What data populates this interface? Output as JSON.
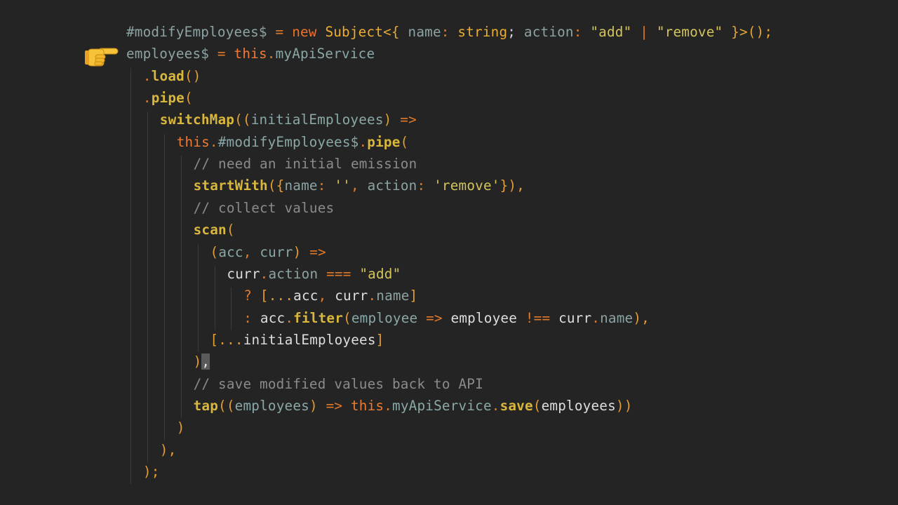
{
  "editor": {
    "theme": {
      "background": "#242424",
      "keyword": "#f0712a",
      "type": "#ecae2e",
      "string": "#d3c45c",
      "function": "#d8b73c",
      "comment": "#8b8b8b",
      "field": "#8da3a3",
      "indent_guide": "#3b3b3b",
      "selection": "#5a5a5a"
    },
    "pointer_icon": "pointing-hand-emoji",
    "lines": [
      {
        "indent": 0,
        "tokens": [
          {
            "t": "#modifyEmployees$",
            "c": "field"
          },
          {
            "t": " = ",
            "c": "op"
          },
          {
            "t": "new",
            "c": "kw"
          },
          {
            "t": " ",
            "c": "plain"
          },
          {
            "t": "Subject",
            "c": "type"
          },
          {
            "t": "<{ ",
            "c": "punct"
          },
          {
            "t": "name",
            "c": "field"
          },
          {
            "t": ": ",
            "c": "op"
          },
          {
            "t": "string",
            "c": "type"
          },
          {
            "t": "; ",
            "c": "plain"
          },
          {
            "t": "action",
            "c": "field"
          },
          {
            "t": ": ",
            "c": "op"
          },
          {
            "t": "\"add\"",
            "c": "str"
          },
          {
            "t": " | ",
            "c": "op"
          },
          {
            "t": "\"remove\"",
            "c": "str"
          },
          {
            "t": " }>();",
            "c": "punct"
          }
        ]
      },
      {
        "indent": 0,
        "tokens": [
          {
            "t": "employees$",
            "c": "field"
          },
          {
            "t": " = ",
            "c": "op"
          },
          {
            "t": "this",
            "c": "this"
          },
          {
            "t": ".",
            "c": "op"
          },
          {
            "t": "myApiService",
            "c": "var"
          }
        ]
      },
      {
        "indent": 1,
        "tokens": [
          {
            "t": ".",
            "c": "op"
          },
          {
            "t": "load",
            "c": "fn"
          },
          {
            "t": "()",
            "c": "paren"
          }
        ]
      },
      {
        "indent": 1,
        "tokens": [
          {
            "t": ".",
            "c": "op"
          },
          {
            "t": "pipe",
            "c": "fn"
          },
          {
            "t": "(",
            "c": "paren"
          }
        ]
      },
      {
        "indent": 2,
        "tokens": [
          {
            "t": "switchMap",
            "c": "fn"
          },
          {
            "t": "((",
            "c": "paren"
          },
          {
            "t": "initialEmployees",
            "c": "var"
          },
          {
            "t": ") ",
            "c": "paren"
          },
          {
            "t": "=>",
            "c": "op"
          }
        ]
      },
      {
        "indent": 3,
        "tokens": [
          {
            "t": "this",
            "c": "this"
          },
          {
            "t": ".",
            "c": "op"
          },
          {
            "t": "#modifyEmployees$",
            "c": "var"
          },
          {
            "t": ".",
            "c": "op"
          },
          {
            "t": "pipe",
            "c": "fn"
          },
          {
            "t": "(",
            "c": "paren"
          }
        ]
      },
      {
        "indent": 4,
        "tokens": [
          {
            "t": "// need an initial emission",
            "c": "cm"
          }
        ]
      },
      {
        "indent": 4,
        "tokens": [
          {
            "t": "startWith",
            "c": "fn"
          },
          {
            "t": "({",
            "c": "paren"
          },
          {
            "t": "name",
            "c": "field"
          },
          {
            "t": ": ",
            "c": "op"
          },
          {
            "t": "''",
            "c": "str"
          },
          {
            "t": ", ",
            "c": "op"
          },
          {
            "t": "action",
            "c": "field"
          },
          {
            "t": ": ",
            "c": "op"
          },
          {
            "t": "'remove'",
            "c": "str"
          },
          {
            "t": "}),",
            "c": "paren"
          }
        ]
      },
      {
        "indent": 4,
        "tokens": [
          {
            "t": "// collect values",
            "c": "cm"
          }
        ]
      },
      {
        "indent": 4,
        "tokens": [
          {
            "t": "scan",
            "c": "fn"
          },
          {
            "t": "(",
            "c": "paren"
          }
        ]
      },
      {
        "indent": 5,
        "tokens": [
          {
            "t": "(",
            "c": "paren"
          },
          {
            "t": "acc",
            "c": "var"
          },
          {
            "t": ", ",
            "c": "op"
          },
          {
            "t": "curr",
            "c": "var"
          },
          {
            "t": ") ",
            "c": "paren"
          },
          {
            "t": "=>",
            "c": "op"
          }
        ]
      },
      {
        "indent": 6,
        "tokens": [
          {
            "t": "curr",
            "c": "white"
          },
          {
            "t": ".",
            "c": "op"
          },
          {
            "t": "action",
            "c": "field"
          },
          {
            "t": " === ",
            "c": "op"
          },
          {
            "t": "\"add\"",
            "c": "str"
          }
        ]
      },
      {
        "indent": 7,
        "tokens": [
          {
            "t": "? ",
            "c": "op"
          },
          {
            "t": "[...",
            "c": "paren"
          },
          {
            "t": "acc",
            "c": "white"
          },
          {
            "t": ", ",
            "c": "op"
          },
          {
            "t": "curr",
            "c": "white"
          },
          {
            "t": ".",
            "c": "op"
          },
          {
            "t": "name",
            "c": "field"
          },
          {
            "t": "]",
            "c": "paren"
          }
        ]
      },
      {
        "indent": 7,
        "tokens": [
          {
            "t": ": ",
            "c": "op"
          },
          {
            "t": "acc",
            "c": "white"
          },
          {
            "t": ".",
            "c": "op"
          },
          {
            "t": "filter",
            "c": "fn"
          },
          {
            "t": "(",
            "c": "paren"
          },
          {
            "t": "employee",
            "c": "var"
          },
          {
            "t": " => ",
            "c": "op"
          },
          {
            "t": "employee",
            "c": "white"
          },
          {
            "t": " !== ",
            "c": "op"
          },
          {
            "t": "curr",
            "c": "white"
          },
          {
            "t": ".",
            "c": "op"
          },
          {
            "t": "name",
            "c": "field"
          },
          {
            "t": "),",
            "c": "paren"
          }
        ]
      },
      {
        "indent": 5,
        "tokens": [
          {
            "t": "[...",
            "c": "paren"
          },
          {
            "t": "initialEmployees",
            "c": "white"
          },
          {
            "t": "]",
            "c": "paren"
          }
        ]
      },
      {
        "indent": 4,
        "tokens": [
          {
            "t": ")",
            "c": "paren"
          },
          {
            "t": ",",
            "c": "sel"
          }
        ]
      },
      {
        "indent": 4,
        "tokens": [
          {
            "t": "// save modified values back to API",
            "c": "cm"
          }
        ]
      },
      {
        "indent": 4,
        "tokens": [
          {
            "t": "tap",
            "c": "fn"
          },
          {
            "t": "((",
            "c": "paren"
          },
          {
            "t": "employees",
            "c": "var"
          },
          {
            "t": ") ",
            "c": "paren"
          },
          {
            "t": "=> ",
            "c": "op"
          },
          {
            "t": "this",
            "c": "this"
          },
          {
            "t": ".",
            "c": "op"
          },
          {
            "t": "myApiService",
            "c": "var"
          },
          {
            "t": ".",
            "c": "op"
          },
          {
            "t": "save",
            "c": "fn"
          },
          {
            "t": "(",
            "c": "paren"
          },
          {
            "t": "employees",
            "c": "white"
          },
          {
            "t": "))",
            "c": "paren"
          }
        ]
      },
      {
        "indent": 3,
        "tokens": [
          {
            "t": ")",
            "c": "paren"
          }
        ]
      },
      {
        "indent": 2,
        "tokens": [
          {
            "t": "),",
            "c": "paren"
          }
        ]
      },
      {
        "indent": 1,
        "tokens": [
          {
            "t": ");",
            "c": "paren"
          }
        ]
      }
    ]
  }
}
